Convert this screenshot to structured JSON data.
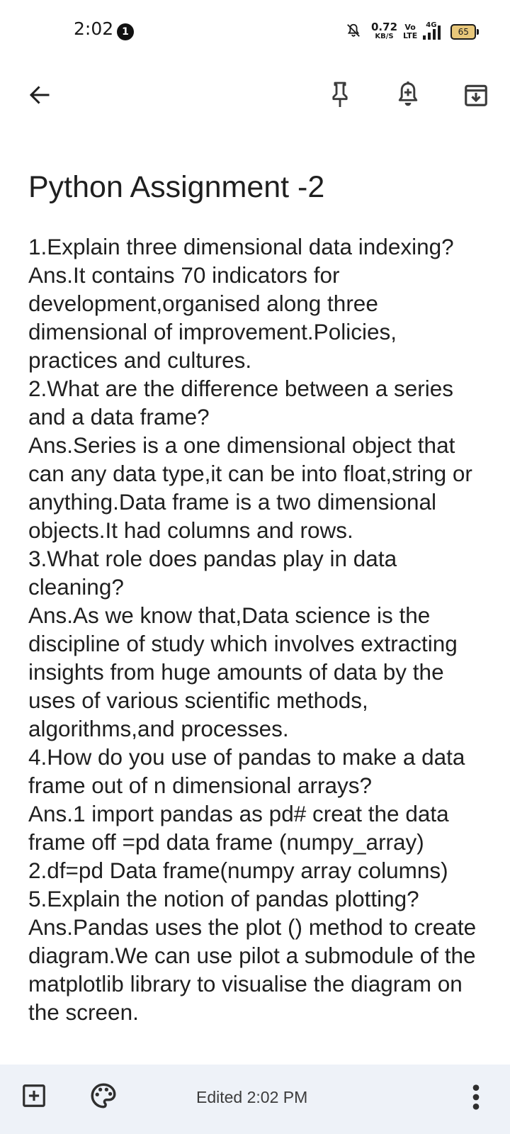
{
  "status_bar": {
    "time": "2:02",
    "notification_count": "1",
    "net_speed_value": "0.72",
    "net_speed_unit": "KB/S",
    "volte_top": "Vo",
    "volte_bottom": "LTE",
    "network_type": "4G",
    "battery_level": "65",
    "battery_color": "#e8c77a"
  },
  "app_bar": {
    "back_icon": "arrow-left-icon",
    "pin_icon": "pin-icon",
    "reminder_icon": "bell-plus-icon",
    "archive_icon": "archive-icon"
  },
  "note": {
    "title": "Python Assignment -2",
    "body": "1.Explain three dimensional data indexing?\nAns.It contains 70 indicators for development,organised along three dimensional of improvement.Policies, practices and cultures.\n2.What are the difference between a series and a data frame?\nAns.Series is a one dimensional object that can any data type,it can be into float,string or anything.Data frame is a two dimensional objects.It had columns and rows.\n3.What role does pandas play in data cleaning?\nAns.As we know that,Data science is the discipline of study which involves extracting insights from huge amounts of data by the uses of various scientific methods, algorithms,and processes.\n4.How do you use of pandas to make a data frame out of n dimensional arrays?\nAns.1 import pandas as pd# creat the data frame off =pd data frame (numpy_array)\n2.df=pd Data frame(numpy array columns)\n5.Explain the notion of pandas plotting?\nAns.Pandas uses the plot () method to create diagram.We can use pilot a submodule of the matplotlib library to visualise the diagram on the screen."
  },
  "bottom_bar": {
    "edited_label": "Edited 2:02 PM",
    "background": "#eef2f8"
  }
}
